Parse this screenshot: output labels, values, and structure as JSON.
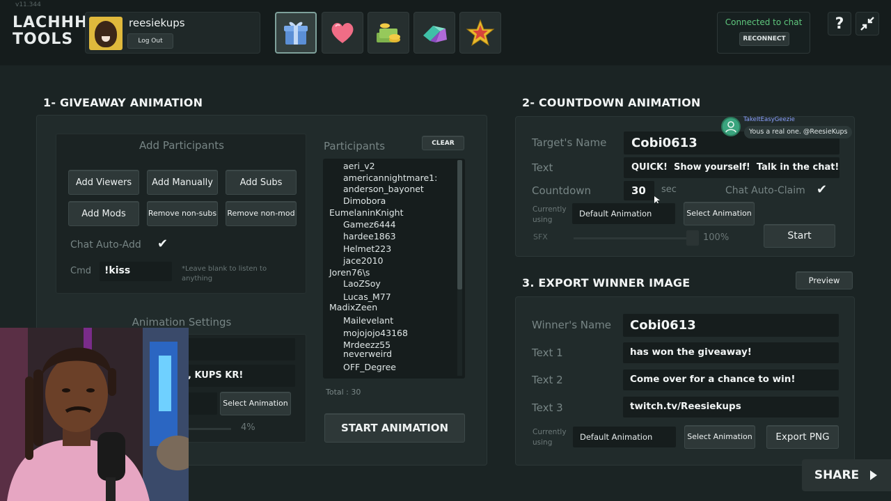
{
  "header": {
    "version": "v11.344",
    "logo_line1": "LACHHH",
    "logo_line2": "TOOLS",
    "username": "reesiekups",
    "logout_label": "Log Out",
    "tools": [
      {
        "icon": "gift-icon",
        "active": true
      },
      {
        "icon": "heart-icon",
        "active": false
      },
      {
        "icon": "money-icon",
        "active": false
      },
      {
        "icon": "gem-icon",
        "active": false
      },
      {
        "icon": "star-icon",
        "active": false
      }
    ],
    "chat_status": "Connected to chat",
    "reconnect_label": "RECONNECT",
    "help_label": "?"
  },
  "giveaway": {
    "title": "1- GIVEAWAY ANIMATION",
    "add_participants_label": "Add Participants",
    "buttons": {
      "add_viewers": "Add Viewers",
      "add_manually": "Add Manually",
      "add_subs": "Add Subs",
      "add_mods": "Add Mods",
      "remove_nonsubs": "Remove non-subs",
      "remove_nonmod": "Remove non-mod"
    },
    "chat_auto_add_label": "Chat Auto-Add",
    "chat_auto_add_checked": true,
    "cmd_label": "Cmd",
    "cmd_value": "!kiss",
    "cmd_hint": "*Leave blank to listen to anything",
    "participants_label": "Participants",
    "clear_label": "CLEAR",
    "participants": [
      "aeri_v2",
      "americannightmare1:",
      "anderson_bayonet",
      "Dimobora",
      "EumelaninKnight",
      "Gamez6444",
      "hardee1863",
      "Helmet223",
      "jace2010",
      "Joren76\\s",
      "LaoZSoy",
      "Lucas_M77",
      "MadixZeen",
      "Mailevelant",
      "mojojojo43168",
      "Mrdeezz55",
      "neverweird",
      "OFF_Degree"
    ],
    "total_label": "Total : 30",
    "animation_settings_label": "Animation Settings",
    "anim_text_partial": ", KUPS KR!",
    "select_animation_label": "Select Animation",
    "volume_percent": "4%",
    "start_label": "START ANIMATION"
  },
  "countdown": {
    "title": "2- COUNTDOWN ANIMATION",
    "target_label": "Target's Name",
    "target_value": "Cobi0613",
    "text_label": "Text",
    "text_value": "QUICK!  Show yourself!  Talk in the chat!",
    "countdown_label": "Countdown",
    "countdown_value": "30",
    "sec_label": "sec",
    "chat_auto_claim_label": "Chat Auto-Claim",
    "chat_auto_claim_checked": true,
    "currently_using_label": "Currently using",
    "current_animation": "Default Animation",
    "select_animation_label": "Select Animation",
    "sfx_label": "SFX",
    "sfx_percent": "100%",
    "sfx_level": 1.0,
    "start_label": "Start",
    "chat_popup_user": "TakeItEasyGeezie",
    "chat_popup_message": "Yous a real one. @ReesieKups"
  },
  "export": {
    "title": "3. EXPORT WINNER IMAGE",
    "preview_label": "Preview",
    "winner_label": "Winner's Name",
    "winner_value": "Cobi0613",
    "text1_label": "Text 1",
    "text1_value": "has won the giveaway!",
    "text2_label": "Text 2",
    "text2_value": "Come over for a chance to win!",
    "text3_label": "Text 3",
    "text3_value": "twitch.tv/Reesiekups",
    "currently_using_label": "Currently using",
    "current_animation": "Default Animation",
    "select_animation_label": "Select Animation",
    "export_label": "Export PNG"
  },
  "share_label": "SHARE"
}
